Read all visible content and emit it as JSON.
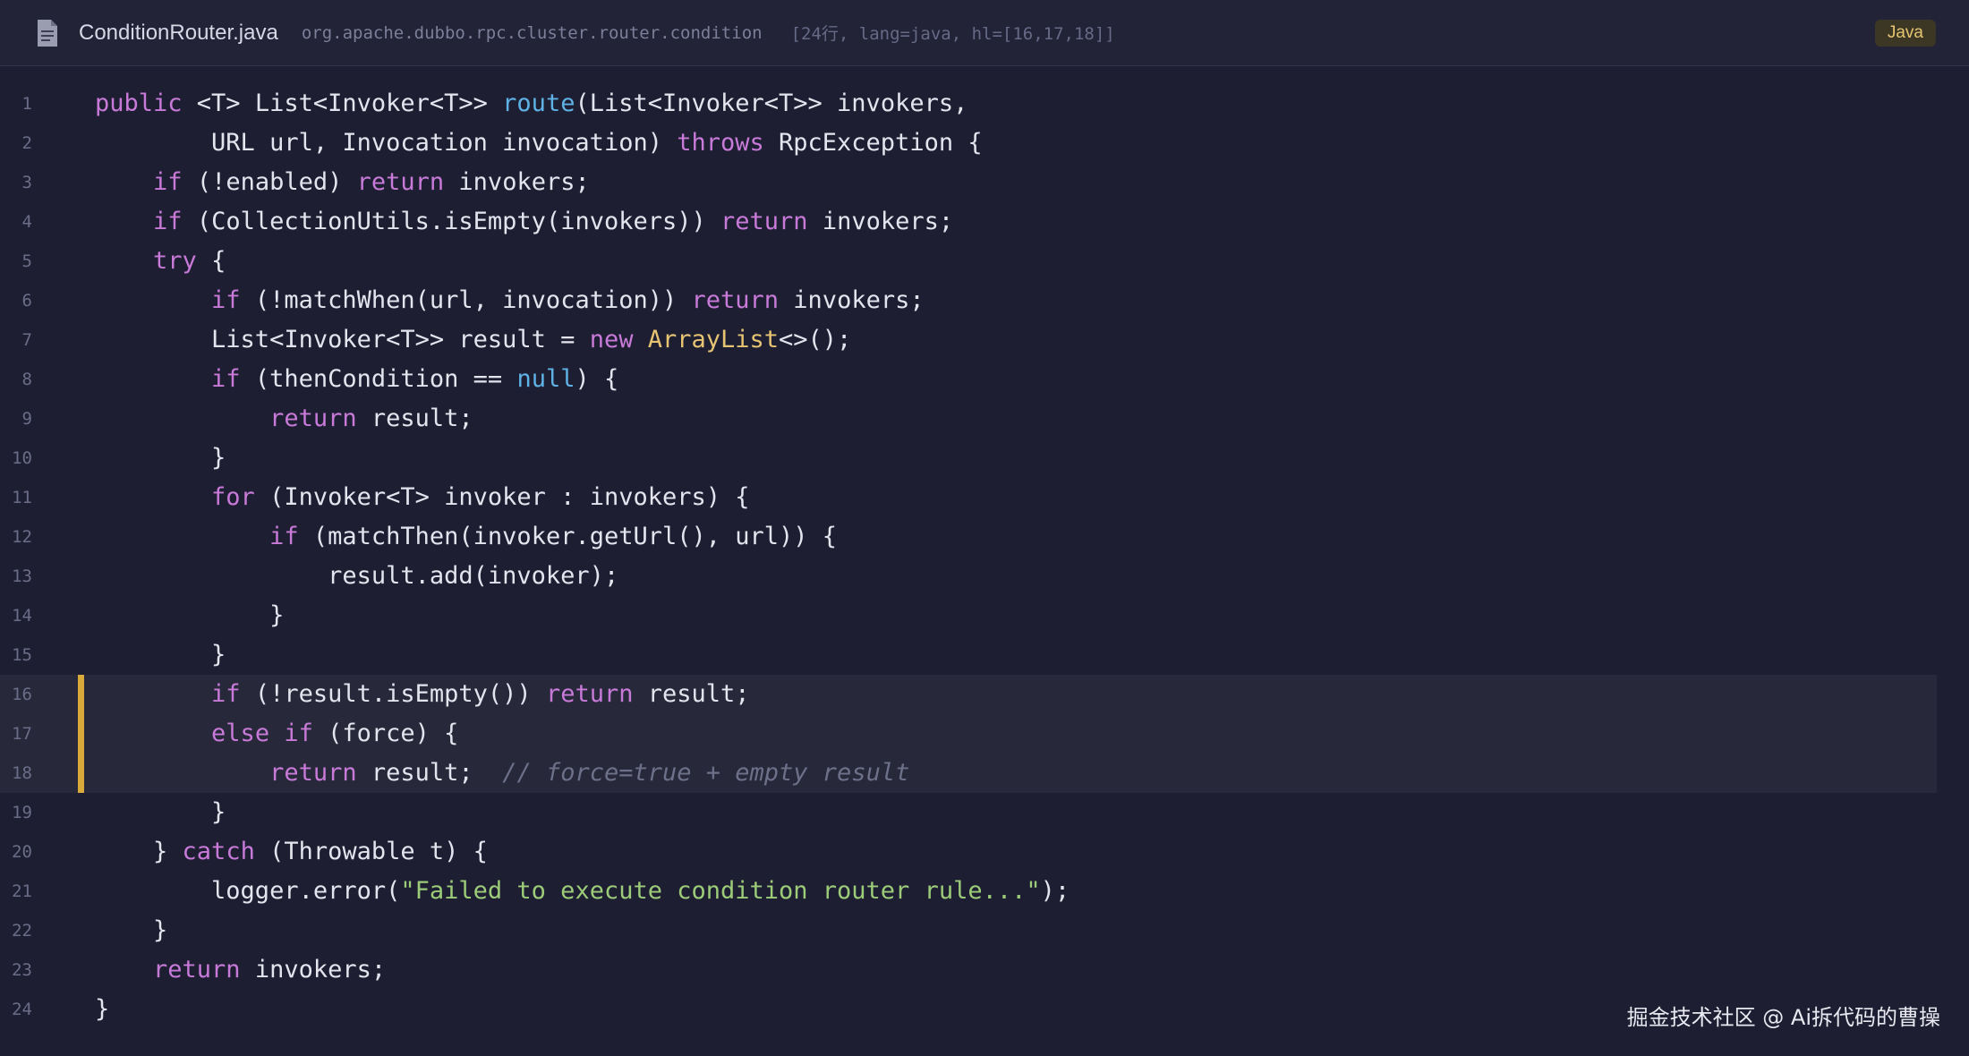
{
  "header": {
    "filename": "ConditionRouter.java",
    "package": "org.apache.dubbo.rpc.cluster.router.condition",
    "meta": "[24行, lang=java, hl=[16,17,18]]",
    "language_badge": "Java",
    "file_icon": "file-icon"
  },
  "colors": {
    "background": "#1e1e33",
    "keyword": "#c87ad8",
    "function": "#5fb2e6",
    "type": "#e6c472",
    "string": "#9ccc78",
    "comment": "#6c7089",
    "highlight_marker": "#d9a93a"
  },
  "highlighted_lines": [
    16,
    17,
    18
  ],
  "lines": [
    {
      "n": "1",
      "tokens": [
        [
          "kw",
          "public "
        ],
        [
          "",
          "<T> List<Invoker<T>> "
        ],
        [
          "fn",
          "route"
        ],
        [
          "",
          "(List<Invoker<T>> invokers,"
        ]
      ]
    },
    {
      "n": "2",
      "tokens": [
        [
          "",
          "        URL url, Invocation invocation) "
        ],
        [
          "kw",
          "throws "
        ],
        [
          "",
          "RpcException {"
        ]
      ]
    },
    {
      "n": "3",
      "tokens": [
        [
          "",
          "    "
        ],
        [
          "kw",
          "if "
        ],
        [
          "",
          "(!enabled) "
        ],
        [
          "kw",
          "return "
        ],
        [
          "",
          "invokers;"
        ]
      ]
    },
    {
      "n": "4",
      "tokens": [
        [
          "",
          "    "
        ],
        [
          "kw",
          "if "
        ],
        [
          "",
          "(CollectionUtils.isEmpty(invokers)) "
        ],
        [
          "kw",
          "return "
        ],
        [
          "",
          "invokers;"
        ]
      ]
    },
    {
      "n": "5",
      "tokens": [
        [
          "",
          "    "
        ],
        [
          "kw",
          "try "
        ],
        [
          "",
          "{"
        ]
      ]
    },
    {
      "n": "6",
      "tokens": [
        [
          "",
          "        "
        ],
        [
          "kw",
          "if "
        ],
        [
          "",
          "(!matchWhen(url, invocation)) "
        ],
        [
          "kw",
          "return "
        ],
        [
          "",
          "invokers;"
        ]
      ]
    },
    {
      "n": "7",
      "tokens": [
        [
          "",
          "        List<Invoker<T>> result = "
        ],
        [
          "kw",
          "new "
        ],
        [
          "ty",
          "ArrayList"
        ],
        [
          "",
          "<>();"
        ]
      ]
    },
    {
      "n": "8",
      "tokens": [
        [
          "",
          "        "
        ],
        [
          "kw",
          "if "
        ],
        [
          "",
          "(thenCondition == "
        ],
        [
          "lit",
          "null"
        ],
        [
          "",
          ") {"
        ]
      ]
    },
    {
      "n": "9",
      "tokens": [
        [
          "",
          "            "
        ],
        [
          "kw",
          "return "
        ],
        [
          "",
          "result;"
        ]
      ]
    },
    {
      "n": "10",
      "tokens": [
        [
          "",
          "        }"
        ]
      ]
    },
    {
      "n": "11",
      "tokens": [
        [
          "",
          "        "
        ],
        [
          "kw",
          "for "
        ],
        [
          "",
          "(Invoker<T> invoker : invokers) {"
        ]
      ]
    },
    {
      "n": "12",
      "tokens": [
        [
          "",
          "            "
        ],
        [
          "kw",
          "if "
        ],
        [
          "",
          "(matchThen(invoker.getUrl(), url)) {"
        ]
      ]
    },
    {
      "n": "13",
      "tokens": [
        [
          "",
          "                result.add(invoker);"
        ]
      ]
    },
    {
      "n": "14",
      "tokens": [
        [
          "",
          "            }"
        ]
      ]
    },
    {
      "n": "15",
      "tokens": [
        [
          "",
          "        }"
        ]
      ]
    },
    {
      "n": "16",
      "tokens": [
        [
          "",
          "        "
        ],
        [
          "kw",
          "if "
        ],
        [
          "",
          "(!result.isEmpty()) "
        ],
        [
          "kw",
          "return "
        ],
        [
          "",
          "result;"
        ]
      ]
    },
    {
      "n": "17",
      "tokens": [
        [
          "",
          "        "
        ],
        [
          "kw",
          "else if "
        ],
        [
          "",
          "(force) {"
        ]
      ]
    },
    {
      "n": "18",
      "tokens": [
        [
          "",
          "            "
        ],
        [
          "kw",
          "return "
        ],
        [
          "",
          "result;  "
        ],
        [
          "cm",
          "// force=true + empty result"
        ]
      ]
    },
    {
      "n": "19",
      "tokens": [
        [
          "",
          "        }"
        ]
      ]
    },
    {
      "n": "20",
      "tokens": [
        [
          "",
          "    } "
        ],
        [
          "kw",
          "catch "
        ],
        [
          "",
          "(Throwable t) {"
        ]
      ]
    },
    {
      "n": "21",
      "tokens": [
        [
          "",
          "        logger.error("
        ],
        [
          "str",
          "\"Failed to execute condition router rule...\""
        ],
        [
          "",
          ");"
        ]
      ]
    },
    {
      "n": "22",
      "tokens": [
        [
          "",
          "    }"
        ]
      ]
    },
    {
      "n": "23",
      "tokens": [
        [
          "",
          "    "
        ],
        [
          "kw",
          "return "
        ],
        [
          "",
          "invokers;"
        ]
      ]
    },
    {
      "n": "24",
      "tokens": [
        [
          "",
          "}"
        ]
      ]
    }
  ],
  "watermark": "掘金技术社区 @ Ai拆代码的曹操"
}
